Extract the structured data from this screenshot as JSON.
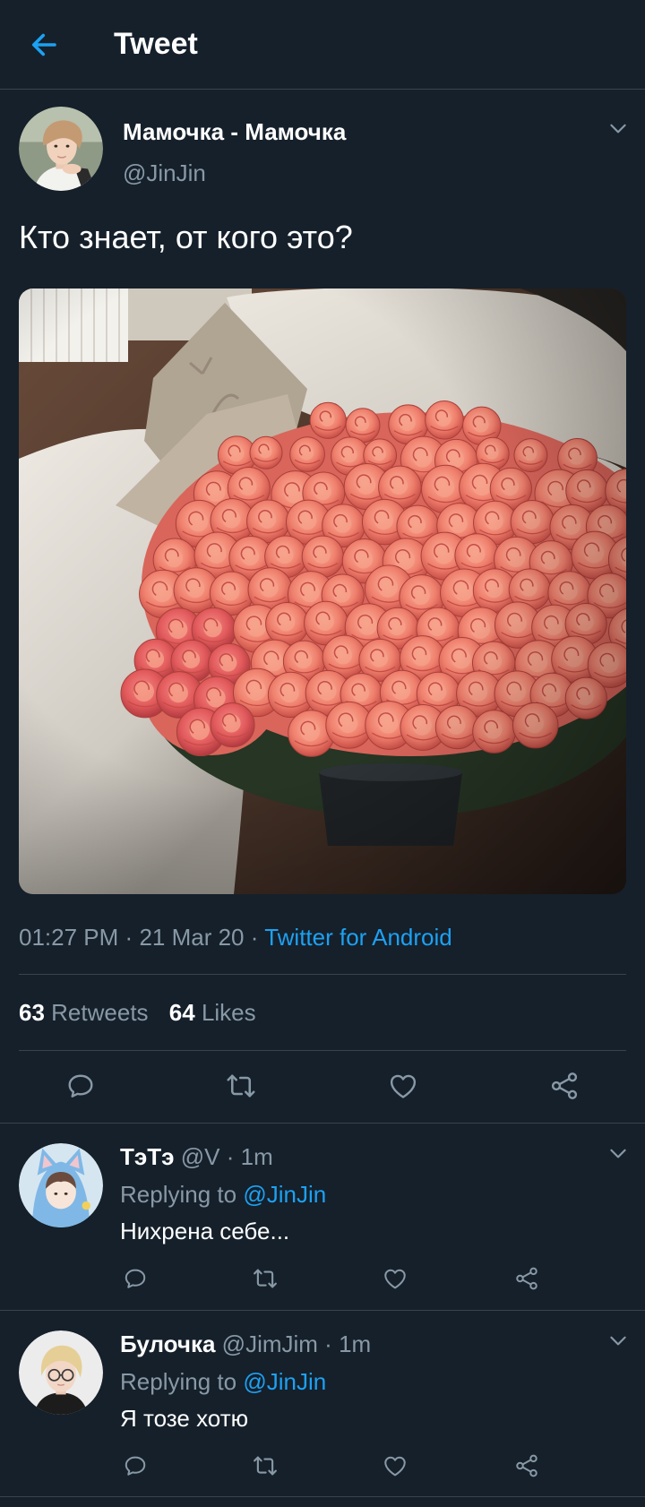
{
  "theme": {
    "background": "#15202b",
    "text": "#ffffff",
    "muted": "#8899a6",
    "accent": "#1da1f2",
    "divider": "#38444d"
  },
  "header": {
    "title": "Tweet",
    "back_icon": "arrow-left-icon"
  },
  "tweet": {
    "author": {
      "name": "Мамочка - Мамочка",
      "handle": "@JinJin"
    },
    "text": "Кто знает, от кого это?",
    "meta": {
      "time": "01:27 PM",
      "separator": "·",
      "date": "21 Mar 20",
      "source": "Twitter for Android"
    },
    "stats": {
      "retweets_count": "63",
      "retweets_label": "Retweets",
      "likes_count": "64",
      "likes_label": "Likes"
    },
    "actions": [
      "reply-icon",
      "retweet-icon",
      "like-icon",
      "share-icon"
    ]
  },
  "replies": [
    {
      "name": "ТэТэ",
      "handle": "@V",
      "separator": "·",
      "time": "1m",
      "replying_label": "Replying to",
      "replying_to": "@JinJin",
      "text": "Нихрена себе..."
    },
    {
      "name": "Булочка",
      "handle": "@JimJim",
      "separator": "·",
      "time": "1m",
      "replying_label": "Replying to",
      "replying_to": "@JinJin",
      "text": "Я тозе хотю"
    }
  ]
}
